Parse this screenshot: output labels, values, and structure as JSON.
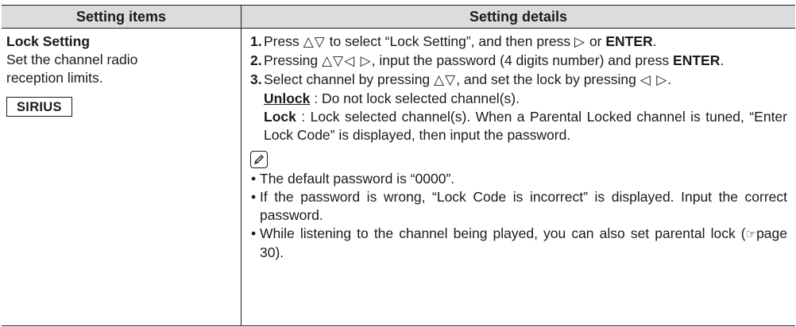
{
  "table": {
    "header_left": "Setting items",
    "header_right": "Setting details"
  },
  "left": {
    "title": "Lock Setting",
    "desc_line1": "Set the channel radio",
    "desc_line2": "reception limits.",
    "badge": "SIRIUS"
  },
  "steps": {
    "s1": {
      "num": "1.",
      "t1": "Press ",
      "sym": "△▽",
      "t2": " to select “Lock Setting”, and then press ",
      "sym2": "▷",
      "t3": " or ",
      "enter": "ENTER",
      "t4": "."
    },
    "s2": {
      "num": "2.",
      "t1": "Pressing ",
      "sym": "△▽◁ ▷",
      "t2": ", input the password (4 digits number) and press ",
      "enter": "ENTER",
      "t3": "."
    },
    "s3": {
      "num": "3.",
      "t1": "Select channel by pressing ",
      "sym": "△▽",
      "t2": ", and set the lock by pressing ",
      "sym2": "◁ ▷",
      "t3": ".",
      "unlock_label": "Unlock",
      "unlock_text": " : Do not lock selected channel(s).",
      "lock_label": "Lock",
      "lock_text": " : Lock selected channel(s). When a Parental Locked channel is tuned, “Enter Lock Code” is displayed, then input the password."
    }
  },
  "notes": {
    "n1": "The default password is “0000”.",
    "n2": "If the password is wrong, “Lock Code is incorrect” is displayed. Input the correct password.",
    "n3a": "While listening to the channel being played, you can also set parental lock (",
    "n3ref": "☞",
    "n3b": "page 30)."
  }
}
